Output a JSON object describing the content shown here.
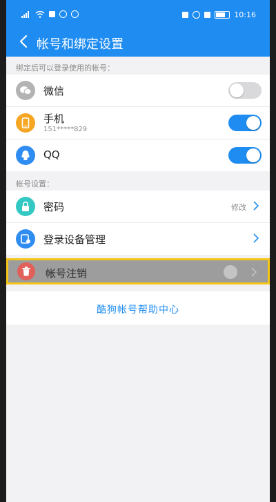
{
  "status_bar": {
    "time": "10:16"
  },
  "header": {
    "title": "帐号和绑定设置"
  },
  "sections": {
    "binding_label": "绑定后可以登录使用的帐号：",
    "account_label": "帐号设置："
  },
  "binding_rows": [
    {
      "label": "微信",
      "icon": "wechat-icon",
      "toggle_on": false,
      "icon_color": "#b3b3b3"
    },
    {
      "label": "手机",
      "sub": "151*****829",
      "icon": "phone-icon",
      "toggle_on": true,
      "icon_color": "#f5a623"
    },
    {
      "label": "QQ",
      "icon": "qq-icon",
      "toggle_on": true,
      "icon_color": "#2f8cf0"
    }
  ],
  "account_rows": [
    {
      "label": "密码",
      "value": "修改",
      "icon": "lock-icon",
      "icon_color": "#33c9c2"
    },
    {
      "label": "登录设备管理",
      "icon": "device-icon",
      "icon_color": "#2f8cf0"
    }
  ],
  "highlight_row": {
    "label": "帐号注销",
    "icon": "trash-icon",
    "icon_color": "#e0605a"
  },
  "help": {
    "label": "酷狗帐号帮助中心"
  },
  "colors": {
    "accent": "#1e8cf0",
    "highlight_border": "#f5c518"
  }
}
